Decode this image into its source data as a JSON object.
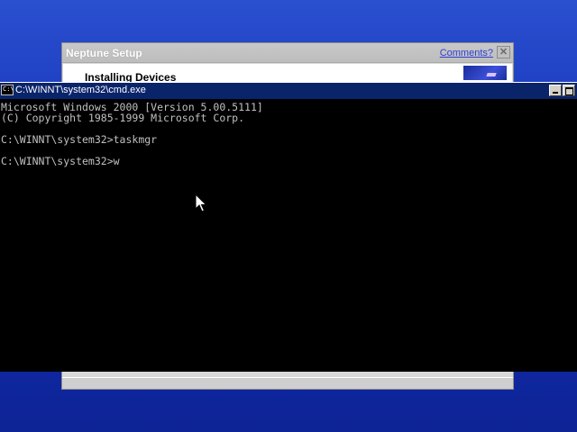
{
  "setup_window": {
    "title": "Neptune Setup",
    "comments_link": "Comments?",
    "close_glyph": "✕",
    "heading": "Installing Devices"
  },
  "cmd_window": {
    "icon_glyph": "C:\\",
    "title": "C:\\WINNT\\system32\\cmd.exe",
    "console_lines": [
      "Microsoft Windows 2000 [Version 5.00.5111]",
      "(C) Copyright 1985-1999 Microsoft Corp.",
      "",
      "C:\\WINNT\\system32>taskmgr",
      "",
      "C:\\WINNT\\system32>w"
    ]
  },
  "icons": {
    "cmd_system_icon": "console-icon",
    "minimize": "minimize-icon",
    "maximize": "maximize-icon",
    "close": "close-icon",
    "cursor": "mouse-pointer-icon"
  },
  "colors": {
    "desktop": "#1a3ac0",
    "cmd_titlebar": "#0a246a",
    "console_background": "#000000",
    "console_text": "#c0c0c0",
    "comments_link": "#2f3fd6"
  }
}
